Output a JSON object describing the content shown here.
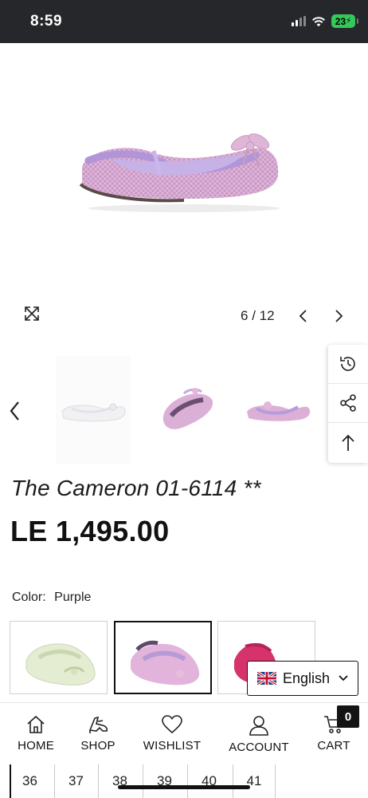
{
  "status_bar": {
    "time": "8:59",
    "battery": "23"
  },
  "gallery": {
    "current": "6",
    "separator": "/",
    "total": "12",
    "expand_icon": "expand-icon",
    "prev_icon": "chevron-left-icon",
    "next_icon": "chevron-right-icon"
  },
  "side_tools": {
    "items": [
      "history-icon",
      "share-icon",
      "arrow-up-icon"
    ]
  },
  "product": {
    "title": "The Cameron 01-6114 **",
    "price": "LE 1,495.00",
    "color_label": "Color:",
    "color_value": "Purple",
    "swatches": [
      "green",
      "purple",
      "pink"
    ],
    "accent_colors": {
      "purple": "#c9a6d8",
      "lilac": "#b89ad6",
      "pink": "#e0a8c6",
      "green": "#e4ecd2",
      "fuchsia": "#d6336c"
    }
  },
  "language": {
    "label": "English",
    "flag_icon": "uk-flag-icon"
  },
  "bottom_nav": {
    "items": [
      {
        "label": "HOME",
        "icon": "home-icon"
      },
      {
        "label": "SHOP",
        "icon": "shoe-icon"
      },
      {
        "label": "WISHLIST",
        "icon": "heart-icon"
      },
      {
        "label": "ACCOUNT",
        "icon": "user-icon"
      },
      {
        "label": "CART",
        "icon": "cart-icon"
      }
    ],
    "cart_count": "0"
  },
  "sizes": [
    "36",
    "37",
    "38",
    "39",
    "40",
    "41"
  ]
}
